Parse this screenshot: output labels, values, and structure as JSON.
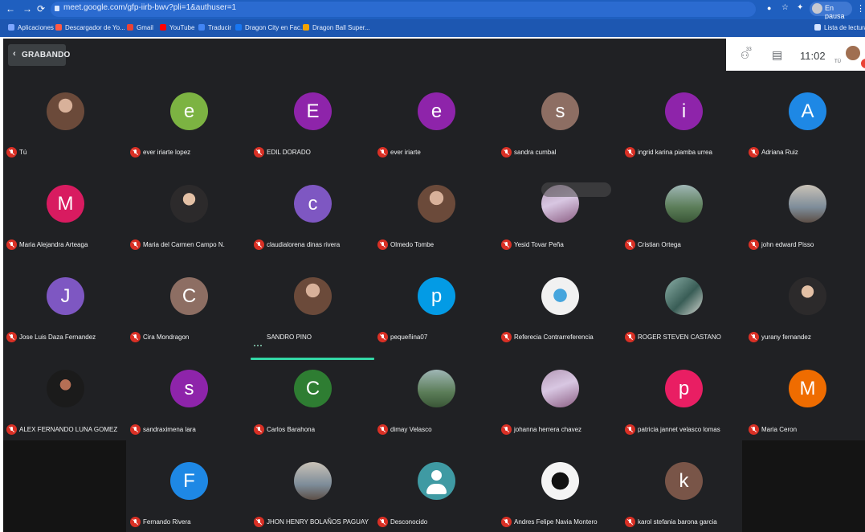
{
  "browser": {
    "url": "meet.google.com/gfp-iirb-bwv?pli=1&authuser=1",
    "profile_status": "En pausa",
    "reading_list": "Lista de lectura",
    "bookmarks": [
      "Aplicaciones",
      "Descargador de Yo...",
      "Gmail",
      "YouTube",
      "Traducir",
      "Dragon City en Fac...",
      "Dragon Ball Super..."
    ]
  },
  "meet": {
    "recording_label": "GRABANDO",
    "participant_count": "33",
    "time": "11:02",
    "self_label": "TÚ"
  },
  "participants": [
    {
      "name": "Tú",
      "initial": "",
      "avatar": "photo",
      "color": "",
      "muted": true
    },
    {
      "name": "ever iriarte lopez",
      "initial": "e",
      "avatar": "letter",
      "color": "#7cb342",
      "muted": true
    },
    {
      "name": "EDIL DORADO",
      "initial": "E",
      "avatar": "letter",
      "color": "#8e24aa",
      "muted": true
    },
    {
      "name": "ever iriarte",
      "initial": "e",
      "avatar": "letter",
      "color": "#8e24aa",
      "muted": true
    },
    {
      "name": "sandra cumbal",
      "initial": "s",
      "avatar": "letter",
      "color": "#8d6e63",
      "muted": true
    },
    {
      "name": "ingrid karina piamba urrea",
      "initial": "i",
      "avatar": "letter",
      "color": "#8e24aa",
      "muted": true
    },
    {
      "name": "Adriana Ruiz",
      "initial": "A",
      "avatar": "letter",
      "color": "#1e88e5",
      "muted": true
    },
    {
      "name": "Maria Alejandra Arteaga",
      "initial": "M",
      "avatar": "letter",
      "color": "#d81b60",
      "muted": true
    },
    {
      "name": "Maria del Carmen Campo N.",
      "initial": "",
      "avatar": "photo2",
      "color": "",
      "muted": true
    },
    {
      "name": "claudialorena dinas rivera",
      "initial": "c",
      "avatar": "letter",
      "color": "#7e57c2",
      "muted": true
    },
    {
      "name": "Olmedo Tombe",
      "initial": "",
      "avatar": "photo",
      "color": "",
      "muted": true
    },
    {
      "name": "Yesid Tovar Peña",
      "initial": "",
      "avatar": "photo3",
      "color": "",
      "muted": true
    },
    {
      "name": "Cristian Ortega",
      "initial": "",
      "avatar": "photo4",
      "color": "",
      "muted": true
    },
    {
      "name": "john edward Pisso",
      "initial": "",
      "avatar": "photo7",
      "color": "",
      "muted": true
    },
    {
      "name": "Jose Luis Daza Fernandez",
      "initial": "J",
      "avatar": "letter",
      "color": "#7e57c2",
      "muted": true
    },
    {
      "name": "Cira Mondragon",
      "initial": "C",
      "avatar": "letter",
      "color": "#8d6e63",
      "muted": true
    },
    {
      "name": "SANDRO PINO",
      "initial": "",
      "avatar": "photo",
      "color": "",
      "muted": false
    },
    {
      "name": "pequeñina07",
      "initial": "p",
      "avatar": "letter",
      "color": "#039be5",
      "muted": true
    },
    {
      "name": "Referecia Contrarreferencia",
      "initial": "",
      "avatar": "photo5",
      "color": "",
      "muted": true
    },
    {
      "name": "ROGER STEVEN CASTANO",
      "initial": "",
      "avatar": "photo9",
      "color": "",
      "muted": true
    },
    {
      "name": "yurany fernandez",
      "initial": "",
      "avatar": "photo2",
      "color": "",
      "muted": true
    },
    {
      "name": "ALEX FERNANDO LUNA GOMEZ",
      "initial": "",
      "avatar": "photo8",
      "color": "",
      "muted": true
    },
    {
      "name": "sandraximena lara",
      "initial": "s",
      "avatar": "letter",
      "color": "#8e24aa",
      "muted": true
    },
    {
      "name": "Carlos Barahona",
      "initial": "C",
      "avatar": "letter",
      "color": "#2e7d32",
      "muted": true
    },
    {
      "name": "dimay Velasco",
      "initial": "",
      "avatar": "photo4",
      "color": "",
      "muted": true
    },
    {
      "name": "johanna herrera chavez",
      "initial": "",
      "avatar": "photo3",
      "color": "",
      "muted": true
    },
    {
      "name": "patricia jannet velasco lomas",
      "initial": "p",
      "avatar": "letter",
      "color": "#e91e63",
      "muted": true
    },
    {
      "name": "Maria Ceron",
      "initial": "M",
      "avatar": "letter",
      "color": "#ef6c00",
      "muted": true
    },
    {
      "name": "Fernando Rivera",
      "initial": "F",
      "avatar": "letter",
      "color": "#1e88e5",
      "muted": true
    },
    {
      "name": "JHON HENRY BOLAÑOS PAGUAY",
      "initial": "",
      "avatar": "photo7",
      "color": "",
      "muted": true
    },
    {
      "name": "Desconocido",
      "initial": "",
      "avatar": "generic",
      "color": "",
      "muted": true
    },
    {
      "name": "Andres Felipe Navia Montero",
      "initial": "",
      "avatar": "photo6",
      "color": "",
      "muted": true
    },
    {
      "name": "karol stefania barona garcia",
      "initial": "k",
      "avatar": "letter",
      "color": "#795548",
      "muted": true
    }
  ]
}
